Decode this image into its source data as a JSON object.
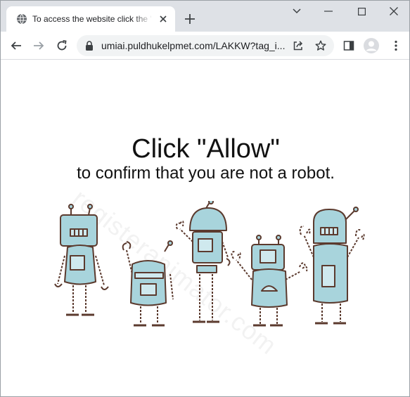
{
  "browser": {
    "tab": {
      "title": "To access the website click the \"Allow\" button",
      "favicon": "globe-icon"
    },
    "url": "umiai.puldhukelpmet.com/LAKKW?tag_i...",
    "colors": {
      "tabstrip": "#dee1e6",
      "omnibox": "#f1f3f4",
      "icon": "#5f6368"
    }
  },
  "page": {
    "headline": "Click \"Allow\"",
    "subline": "to confirm that you are not a robot.",
    "watermark": "registeranimator.com",
    "robot_colors": {
      "body": "#a8d4dc",
      "outline": "#5b3a2e",
      "screen": "#cfe9ee"
    }
  }
}
